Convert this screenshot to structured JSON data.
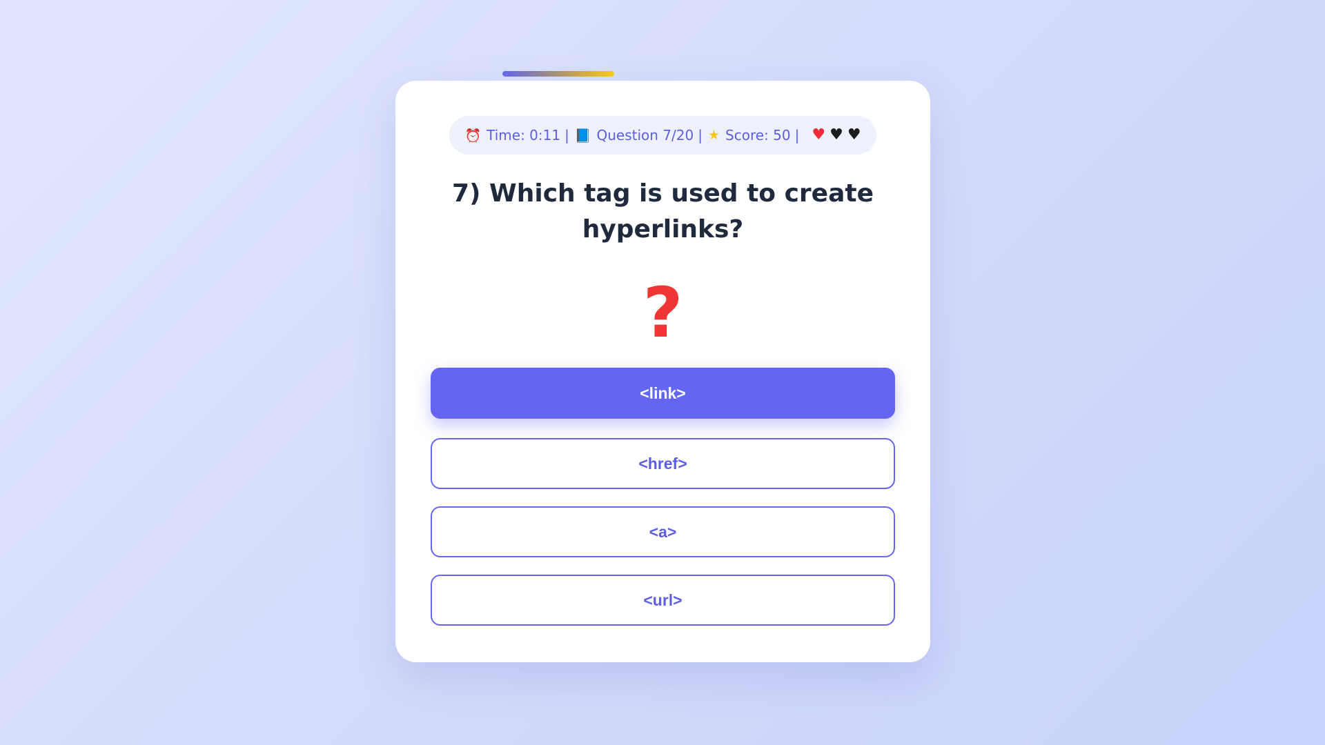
{
  "progress": {
    "fraction": 0.35
  },
  "status": {
    "time_icon": "alarm-clock-icon",
    "time": "Time: 0:11",
    "question_icon": "blue-book-icon",
    "question": "Question 7/20",
    "score_icon": "star-icon",
    "score": "Score: 50",
    "separator": "|",
    "lives": [
      {
        "state": "full",
        "color": "#ef2b3c"
      },
      {
        "state": "empty",
        "color": "#1c1c1c"
      },
      {
        "state": "empty",
        "color": "#1c1c1c"
      }
    ]
  },
  "question": {
    "text": "7) Which tag is used to create hyperlinks?",
    "icon": "?"
  },
  "options": [
    {
      "label": "<link>",
      "selected": true
    },
    {
      "label": "<href>",
      "selected": false
    },
    {
      "label": "<a>",
      "selected": false
    },
    {
      "label": "<url>",
      "selected": false
    }
  ],
  "colors": {
    "accent": "#6366f1",
    "text": "#1f2a3c",
    "question_mark": "#f03535"
  }
}
